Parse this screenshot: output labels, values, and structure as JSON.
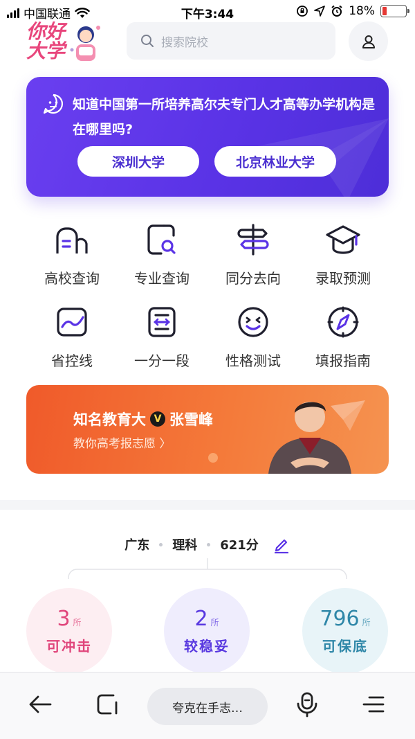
{
  "status_bar": {
    "carrier": "中国联通",
    "time": "下午3:44",
    "battery_text": "18%",
    "battery_level": 0.18
  },
  "header": {
    "logo_text": "你好大学",
    "search_placeholder": "搜索院校"
  },
  "question_card": {
    "question": "知道中国第一所培养高尔夫专门人才高等办学机构是在哪里吗?",
    "options": [
      "深圳大学",
      "北京林业大学"
    ]
  },
  "features": [
    {
      "label": "高校查询",
      "icon": "school-building-icon"
    },
    {
      "label": "专业查询",
      "icon": "major-search-icon"
    },
    {
      "label": "同分去向",
      "icon": "signpost-icon"
    },
    {
      "label": "录取预测",
      "icon": "graduation-cap-icon"
    },
    {
      "label": "省控线",
      "icon": "trend-line-icon"
    },
    {
      "label": "一分一段",
      "icon": "score-segment-icon"
    },
    {
      "label": "性格测试",
      "icon": "smile-face-icon"
    },
    {
      "label": "填报指南",
      "icon": "compass-icon"
    }
  ],
  "banner": {
    "title_left": "知名教育大",
    "badge": "V",
    "title_right": "张雪峰",
    "subtitle": "教你高考报志愿 〉"
  },
  "score": {
    "province": "广东",
    "subject": "理科",
    "score": "621分"
  },
  "results": [
    {
      "count": "3",
      "unit": "所",
      "label": "可冲击"
    },
    {
      "count": "2",
      "unit": "所",
      "label": "较稳妥"
    },
    {
      "count": "796",
      "unit": "所",
      "label": "可保底"
    }
  ],
  "bottom_bar": {
    "center_label": "夸克在手志…"
  },
  "colors": {
    "primary_purple": "#5a33e6",
    "banner_orange": "#f05a2a",
    "rush_pink": "#e0457b",
    "safe_blue": "#2f87a8"
  }
}
